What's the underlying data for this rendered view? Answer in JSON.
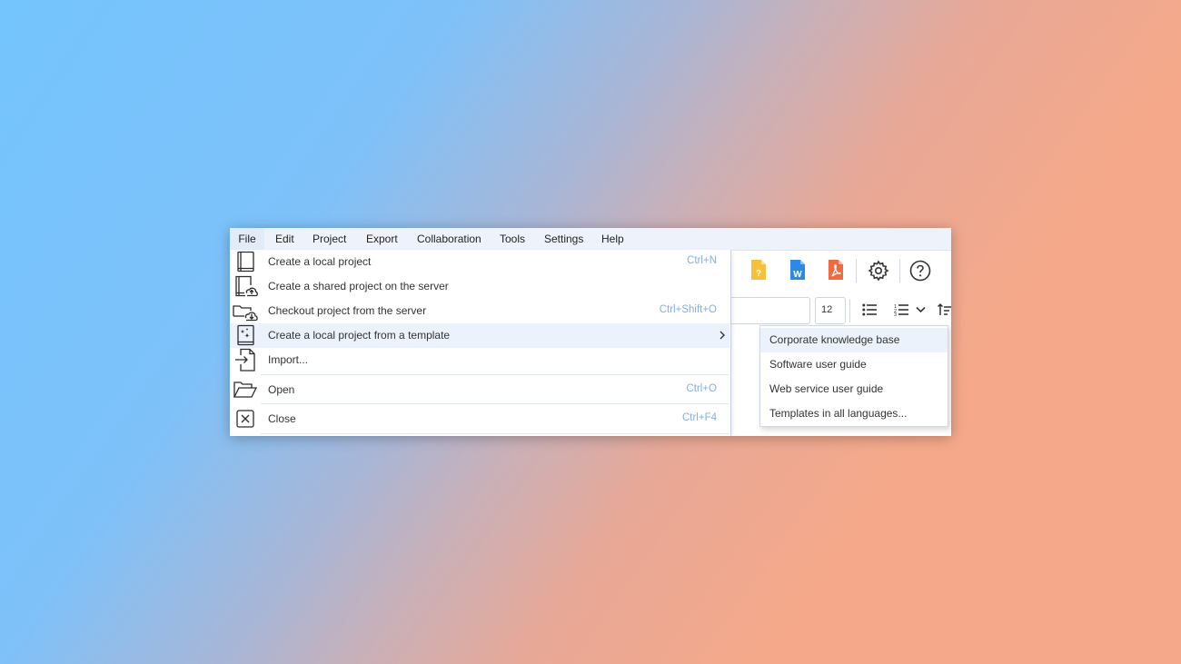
{
  "menubar": {
    "items": [
      {
        "label": "File"
      },
      {
        "label": "Edit"
      },
      {
        "label": "Project"
      },
      {
        "label": "Export"
      },
      {
        "label": "Collaboration"
      },
      {
        "label": "Tools"
      },
      {
        "label": "Settings"
      },
      {
        "label": "Help"
      }
    ]
  },
  "toolbar": {
    "icons": [
      "help-file-icon",
      "word-file-icon",
      "pdf-file-icon",
      "gear-icon",
      "help-circle-icon"
    ],
    "font_size_value": "12",
    "format_icons": [
      "bullet-list-icon",
      "numbered-list-icon",
      "chevron-down-icon",
      "sort-icon"
    ]
  },
  "file_menu": {
    "items": [
      {
        "label": "Create a local project",
        "shortcut": "Ctrl+N",
        "icon": "book-icon"
      },
      {
        "label": "Create a shared project on the server",
        "shortcut": "",
        "icon": "book-upload-icon"
      },
      {
        "label": "Checkout project from the server",
        "shortcut": "Ctrl+Shift+O",
        "icon": "cloud-download-icon"
      },
      {
        "label": "Create a local project from a template",
        "shortcut": "",
        "icon": "template-icon",
        "has_submenu": true
      },
      {
        "label": "Import...",
        "shortcut": "",
        "icon": "import-icon"
      },
      {
        "label": "Open",
        "shortcut": "Ctrl+O",
        "icon": "folder-open-icon"
      },
      {
        "label": "Close",
        "shortcut": "Ctrl+F4",
        "icon": "close-icon"
      }
    ]
  },
  "template_submenu": {
    "items": [
      {
        "label": "Corporate knowledge base"
      },
      {
        "label": "Software user guide"
      },
      {
        "label": "Web service user guide"
      },
      {
        "label": "Templates in all languages..."
      }
    ]
  },
  "colors": {
    "menubar_bg": "#eef3fb",
    "highlight": "#ebf2fc",
    "shortcut_text": "#82aee6",
    "help_file": "#f5c13b",
    "word_file": "#2b8ae6",
    "pdf_file": "#f06a3f"
  }
}
